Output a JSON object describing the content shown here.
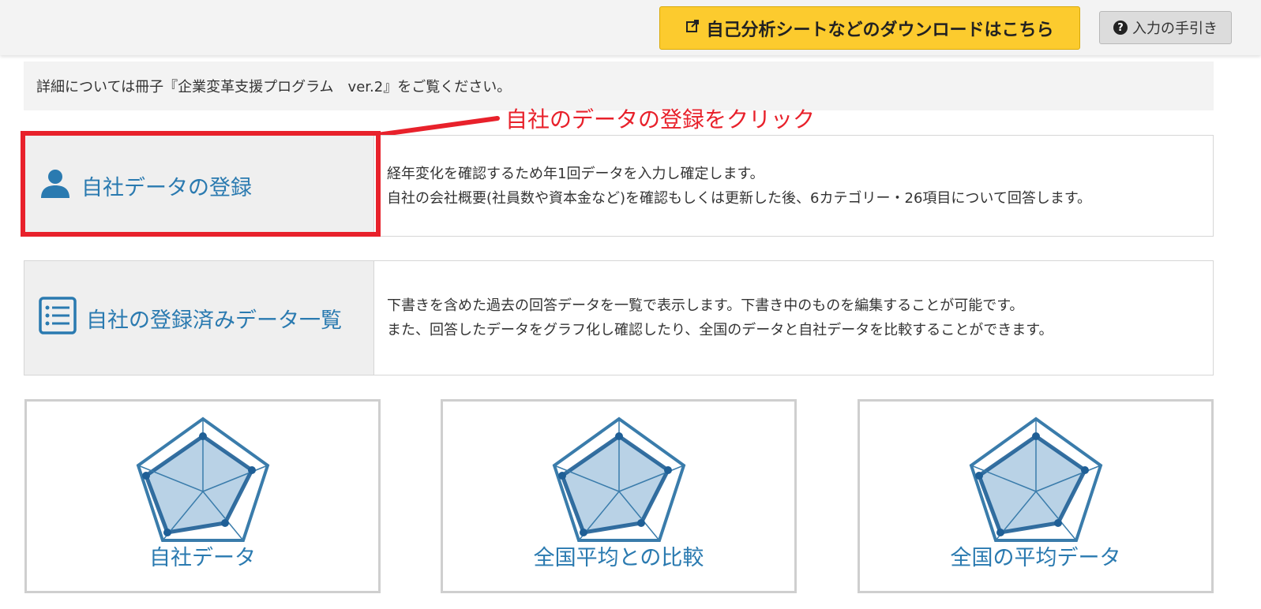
{
  "header": {
    "download_label": "自己分析シートなどのダウンロードはこちら",
    "help_label": "入力の手引き",
    "help_icon": "?"
  },
  "notice": {
    "text": "詳細については冊子『企業変革支援プログラム　ver.2』をご覧ください。"
  },
  "callout": {
    "text": "自社のデータの登録をクリック"
  },
  "cards": [
    {
      "title": "自社データの登録",
      "icon": "user-icon",
      "lines": [
        "経年変化を確認するため年1回データを入力し確定します。",
        "自社の会社概要(社員数や資本金など)を確認もしくは更新した後、6カテゴリー・26項目について回答します。"
      ]
    },
    {
      "title": "自社の登録済みデータ一覧",
      "icon": "list-icon",
      "lines": [
        "下書きを含めた過去の回答データを一覧で表示します。下書き中のものを編集することが可能です。",
        "また、回答したデータをグラフ化し確認したり、全国のデータと自社データを比較することができます。"
      ]
    }
  ],
  "tiles": [
    {
      "label": "自社データ",
      "icon": "radar-chart-icon"
    },
    {
      "label": "全国平均との比較",
      "icon": "radar-chart-icon"
    },
    {
      "label": "全国の平均データ",
      "icon": "radar-chart-icon"
    }
  ],
  "colors": {
    "accent_blue": "#2a7ab0",
    "download_yellow": "#fccb2e",
    "highlight_red": "#e8212b"
  }
}
